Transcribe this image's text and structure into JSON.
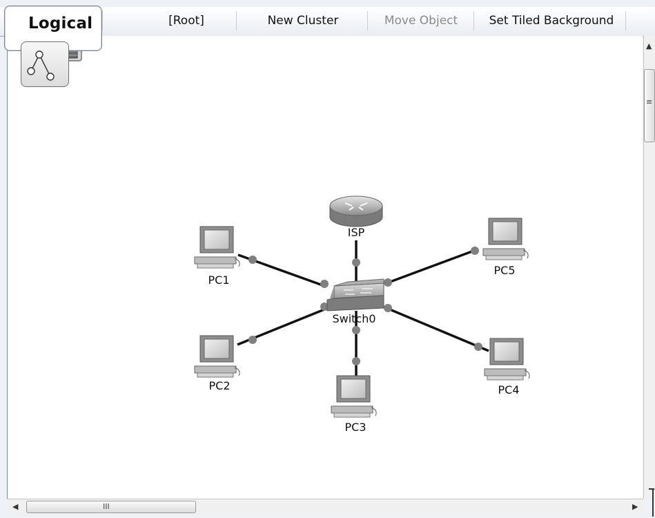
{
  "toolbar": {
    "tab_label": "Logical",
    "buttons": [
      {
        "label": "[Root]",
        "enabled": true
      },
      {
        "label": "New Cluster",
        "enabled": true
      },
      {
        "label": "Move Object",
        "enabled": false
      },
      {
        "label": "Set Tiled Background",
        "enabled": true
      }
    ]
  },
  "network": {
    "devices": [
      {
        "id": "isp",
        "label": "ISP",
        "type": "router"
      },
      {
        "id": "switch0",
        "label": "Switch0",
        "type": "switch"
      },
      {
        "id": "pc1",
        "label": "PC1",
        "type": "pc"
      },
      {
        "id": "pc2",
        "label": "PC2",
        "type": "pc"
      },
      {
        "id": "pc3",
        "label": "PC3",
        "type": "pc"
      },
      {
        "id": "pc4",
        "label": "PC4",
        "type": "pc"
      },
      {
        "id": "pc5",
        "label": "PC5",
        "type": "pc"
      }
    ],
    "links": [
      {
        "from": "switch0",
        "to": "isp"
      },
      {
        "from": "switch0",
        "to": "pc1"
      },
      {
        "from": "switch0",
        "to": "pc2"
      },
      {
        "from": "switch0",
        "to": "pc3"
      },
      {
        "from": "switch0",
        "to": "pc4"
      },
      {
        "from": "switch0",
        "to": "pc5"
      }
    ],
    "link_status_color": "#7a7a7a"
  },
  "icons": {
    "logical_view": "topology-icon",
    "cluster_stack": "server-stack-icon",
    "scroll_up": "chevron-up-icon",
    "scroll_left": "chevron-left-icon",
    "scroll_right": "chevron-right-icon"
  }
}
